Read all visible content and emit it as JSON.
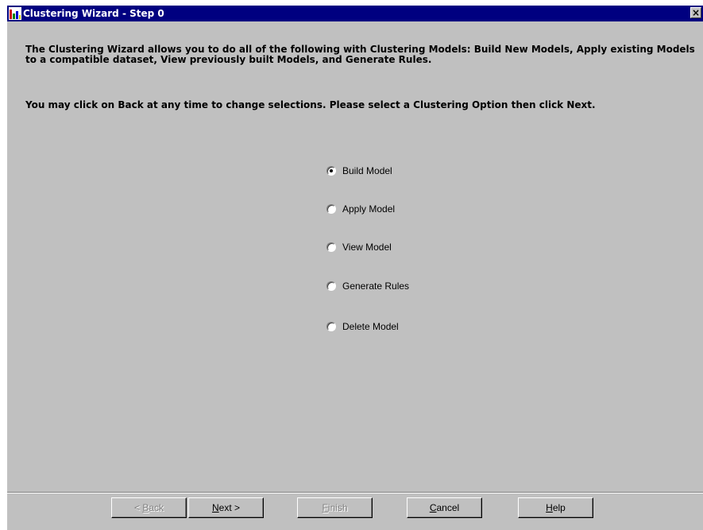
{
  "window": {
    "title": "Clustering Wizard - Step 0",
    "close_label": "×"
  },
  "content": {
    "intro": "The Clustering Wizard allows you to do all of the following with Clustering Models: Build New Models, Apply existing Models to a compatible dataset, View previously built Models, and Generate Rules.",
    "instruction": "You may click on Back at any time to change selections. Please select a Clustering Option then click Next."
  },
  "options": [
    {
      "label": "Build Model",
      "selected": true
    },
    {
      "label": "Apply Model",
      "selected": false
    },
    {
      "label": "View Model",
      "selected": false
    },
    {
      "label": "Generate Rules",
      "selected": false
    },
    {
      "label": "Delete Model",
      "selected": false
    }
  ],
  "buttons": {
    "back": {
      "label": "< Back",
      "mnemonic": "B",
      "enabled": false
    },
    "next": {
      "label": "Next >",
      "mnemonic": "N",
      "enabled": true
    },
    "finish": {
      "label": "Finish",
      "mnemonic": "F",
      "enabled": false
    },
    "cancel": {
      "label": "Cancel",
      "mnemonic": "C",
      "enabled": true
    },
    "help": {
      "label": "Help",
      "mnemonic": "H",
      "enabled": true
    }
  },
  "colors": {
    "titlebar": "#000080",
    "face": "#c0c0c0"
  }
}
